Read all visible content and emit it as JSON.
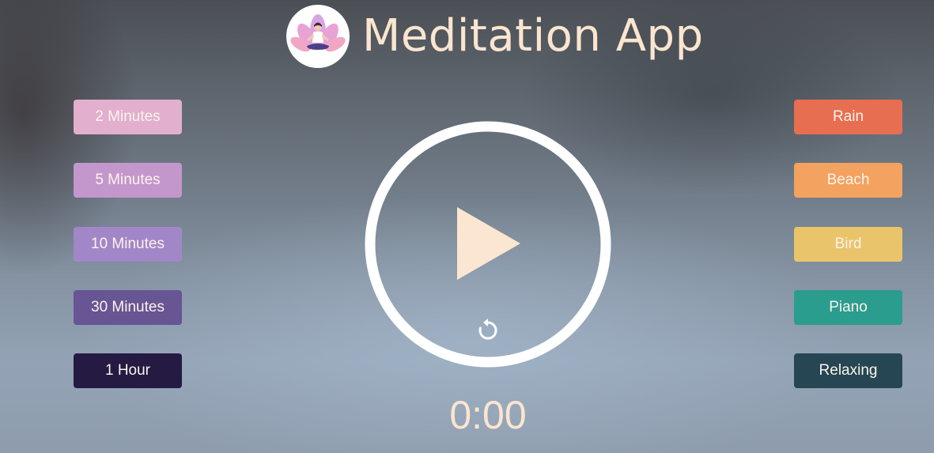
{
  "header": {
    "title": "Meditation App",
    "logo_icon": "meditation-lotus-icon"
  },
  "durations": [
    {
      "label": "2 Minutes",
      "color": "#e2afcf"
    },
    {
      "label": "5 Minutes",
      "color": "#c397cc"
    },
    {
      "label": "10 Minutes",
      "color": "#a287c8"
    },
    {
      "label": "30 Minutes",
      "color": "#675594"
    },
    {
      "label": "1 Hour",
      "color": "#241a42"
    }
  ],
  "sounds": [
    {
      "label": "Rain",
      "color": "#e76e50"
    },
    {
      "label": "Beach",
      "color": "#f3a25f"
    },
    {
      "label": "Bird",
      "color": "#e9c46a"
    },
    {
      "label": "Piano",
      "color": "#2a9d8f"
    },
    {
      "label": "Relaxing",
      "color": "#264653"
    }
  ],
  "player": {
    "play_icon": "play-icon",
    "replay_icon": "replay-icon",
    "ring_color": "#ffffff",
    "play_color": "#fbe6d1"
  },
  "timer": {
    "display": "0:00"
  }
}
